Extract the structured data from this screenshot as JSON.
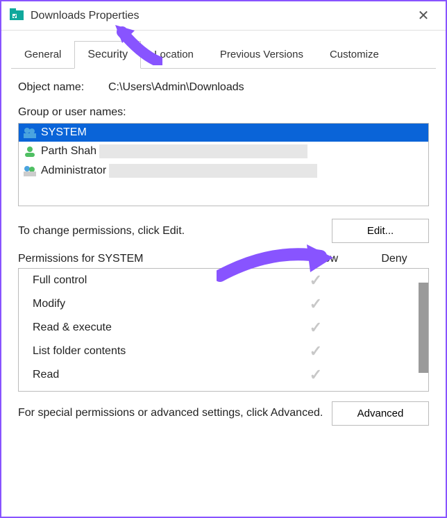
{
  "window": {
    "title": "Downloads Properties"
  },
  "tabs": {
    "general": "General",
    "security": "Security",
    "location": "Location",
    "previous": "Previous Versions",
    "customize": "Customize"
  },
  "object": {
    "label": "Object name:",
    "path": "C:\\Users\\Admin\\Downloads"
  },
  "groups": {
    "label": "Group or user names:",
    "items": [
      {
        "name": "SYSTEM",
        "selected": true
      },
      {
        "name": "Parth Shah",
        "selected": false
      },
      {
        "name": "Administrator",
        "selected": false,
        "truncated": true
      }
    ]
  },
  "edit": {
    "text": "To change permissions, click Edit.",
    "button": "Edit..."
  },
  "permHeader": {
    "title": "Permissions for SYSTEM",
    "allow": "Allow",
    "deny": "Deny"
  },
  "permissions": [
    {
      "name": "Full control",
      "allow": true,
      "deny": false
    },
    {
      "name": "Modify",
      "allow": true,
      "deny": false
    },
    {
      "name": "Read & execute",
      "allow": true,
      "deny": false
    },
    {
      "name": "List folder contents",
      "allow": true,
      "deny": false
    },
    {
      "name": "Read",
      "allow": true,
      "deny": false
    }
  ],
  "advanced": {
    "text": "For special permissions or advanced settings, click Advanced.",
    "button": "Advanced"
  }
}
